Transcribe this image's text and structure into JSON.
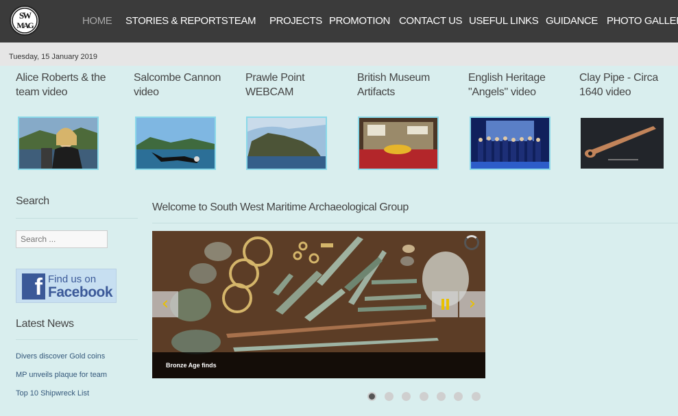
{
  "header": {
    "logo_text": "SWMAG",
    "nav": [
      {
        "label": "HOME",
        "active": true
      },
      {
        "label": "STORIES & REPORTS"
      },
      {
        "label": "TEAM"
      },
      {
        "label": "PROJECTS"
      },
      {
        "label": "PROMOTION"
      },
      {
        "label": "CONTACT US"
      },
      {
        "label": "USEFUL LINKS"
      },
      {
        "label": "GUIDANCE"
      },
      {
        "label": "PHOTO GALLERY"
      }
    ]
  },
  "date": "Tuesday, 15 January 2019",
  "features": [
    {
      "title": "Alice Roberts & the team video",
      "image": "woman-on-boat"
    },
    {
      "title": "Salcombe Cannon video",
      "image": "diver-in-sea"
    },
    {
      "title": "Prawle Point WEBCAM",
      "image": "coastal-headland"
    },
    {
      "title": "British Museum Artifacts",
      "image": "museum-display-case"
    },
    {
      "title": "English Heritage \"Angels\" video",
      "image": "group-on-stage"
    },
    {
      "title": "Clay Pipe - Circa 1640 video",
      "image": "clay-pipe"
    }
  ],
  "sidebar": {
    "search_heading": "Search",
    "search_placeholder": "Search ...",
    "facebook": {
      "line1": "Find us on",
      "line2": "Facebook",
      "color": "#3b5998"
    },
    "news_heading": "Latest News",
    "news": [
      "Divers discover Gold coins",
      "MP unveils plaque for team",
      "Top 10 Shipwreck List"
    ]
  },
  "main": {
    "welcome": "Welcome to South West Maritime Archaeological Group",
    "slider": {
      "caption": "Bronze Age finds",
      "prev_icon": "chevron-left-icon",
      "next_icon": "chevron-right-icon",
      "pause_icon": "pause-icon",
      "slide_count": 7,
      "active_slide": 1
    }
  },
  "colors": {
    "nav_bg": "#3b3b3b",
    "page_bg": "#d9eeee",
    "accent": "#e9c100"
  }
}
